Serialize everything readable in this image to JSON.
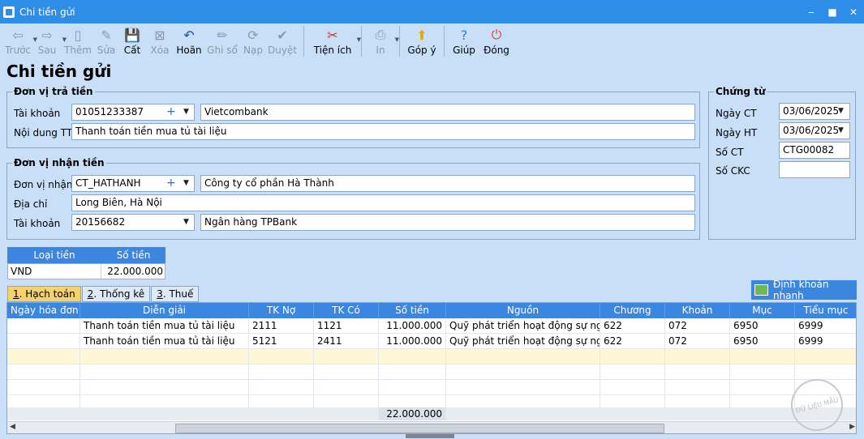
{
  "window": {
    "title": "Chi tiền gửi",
    "minimize": "‒",
    "maximize": "■",
    "close": "✕"
  },
  "toolbar": [
    {
      "id": "prev",
      "label": "Trước",
      "icon": "⇦",
      "enabled": false,
      "dropdown": true
    },
    {
      "id": "next",
      "label": "Sau",
      "icon": "⇨",
      "enabled": false,
      "dropdown": true
    },
    {
      "id": "add",
      "label": "Thêm",
      "icon": "▯",
      "enabled": false
    },
    {
      "id": "edit",
      "label": "Sửa",
      "icon": "✎",
      "enabled": false
    },
    {
      "id": "save",
      "label": "Cất",
      "icon": "💾",
      "enabled": true
    },
    {
      "id": "delete",
      "label": "Xóa",
      "icon": "⊠",
      "enabled": false
    },
    {
      "id": "undo",
      "label": "Hoãn",
      "icon": "↶",
      "enabled": true
    },
    {
      "id": "post",
      "label": "Ghi sổ",
      "icon": "✏",
      "enabled": false
    },
    {
      "id": "load",
      "label": "Nạp",
      "icon": "⟳",
      "enabled": false
    },
    {
      "id": "approve",
      "label": "Duyệt",
      "icon": "✔",
      "enabled": false
    },
    {
      "id": "utility",
      "label": "Tiện ích",
      "icon": "✂",
      "enabled": true,
      "dropdown": true
    },
    {
      "id": "print",
      "label": "In",
      "icon": "⎙",
      "enabled": false,
      "dropdown": true
    },
    {
      "id": "feedback",
      "label": "Góp ý",
      "icon": "⬆",
      "enabled": true
    },
    {
      "id": "help",
      "label": "Giúp",
      "icon": "?",
      "enabled": true
    },
    {
      "id": "close",
      "label": "Đóng",
      "icon": "⏻",
      "enabled": true
    }
  ],
  "heading": "Chi tiền gửi",
  "payer": {
    "legend": "Đơn vị trả tiền",
    "account_label": "Tài khoản",
    "account_value": "01051233387",
    "bank_name": "Vietcombank",
    "content_label": "Nội dung TT",
    "content_value": "Thanh toán tiền mua tủ tài liệu"
  },
  "payee": {
    "legend": "Đơn vị nhận tiền",
    "unit_label": "Đơn vị nhận",
    "unit_value": "CT_HATHANH",
    "unit_name": "Công ty cổ phần Hà Thành",
    "address_label": "Địa chỉ",
    "address_value": "Long Biên, Hà Nội",
    "account_label": "Tài khoản",
    "account_value": "20156682",
    "bank_name": "Ngân hàng TPBank"
  },
  "voucher": {
    "legend": "Chứng từ",
    "date_ct_label": "Ngày CT",
    "date_ct_value": "03/06/2025",
    "date_ht_label": "Ngày HT",
    "date_ht_value": "03/06/2025",
    "so_ct_label": "Số CT",
    "so_ct_value": "CTG00082",
    "so_ckc_label": "Số CKC",
    "so_ckc_value": ""
  },
  "currency": {
    "headers": [
      "Loại tiền",
      "Số tiền"
    ],
    "row": [
      "VND",
      "22.000.000"
    ]
  },
  "tabs": [
    {
      "key": "1",
      "rest": ". Hạch toán",
      "active": true
    },
    {
      "key": "2",
      "rest": ". Thống kê",
      "active": false
    },
    {
      "key": "3",
      "rest": ". Thuế",
      "active": false
    }
  ],
  "quick_button": "Định khoản nhanh",
  "grid": {
    "columns": [
      "Ngày hóa đơn",
      "Diễn giải",
      "TK Nợ",
      "TK Có",
      "Số tiền",
      "Nguồn",
      "Chương",
      "Khoản",
      "Mục",
      "Tiểu mục"
    ],
    "rows": [
      [
        "",
        "Thanh toán tiền mua tủ tài liệu",
        "2111",
        "1121",
        "11.000.000",
        "Quỹ phát triển hoạt động sự nghiệp",
        "622",
        "072",
        "6950",
        "6999"
      ],
      [
        "",
        "Thanh toán tiền mua tủ tài liệu",
        "5121",
        "2411",
        "11.000.000",
        "Quỹ phát triển hoạt động sự nghiệp",
        "622",
        "072",
        "6950",
        "6999"
      ]
    ],
    "total": "22.000.000"
  },
  "watermark": "ĐỮ LIỆU MẪU"
}
